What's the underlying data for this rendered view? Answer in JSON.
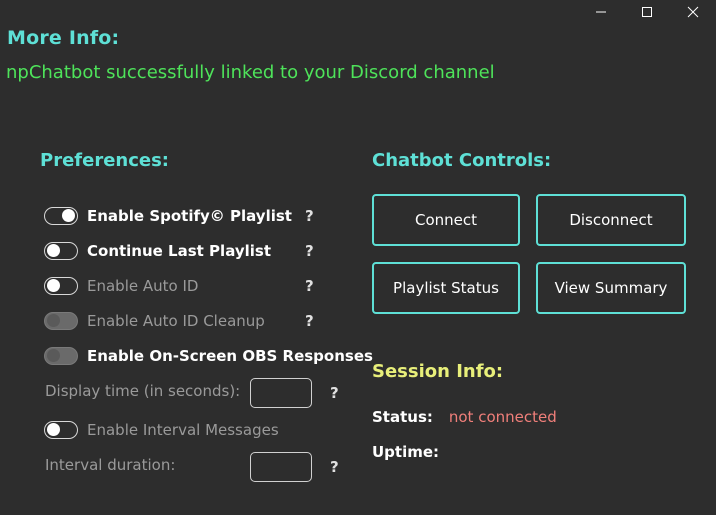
{
  "window": {
    "minimize_icon": "minimize-icon",
    "maximize_icon": "maximize-icon",
    "close_icon": "close-icon"
  },
  "more_info": {
    "title": "More Info:",
    "message": "npChatbot successfully linked to your Discord channel"
  },
  "preferences": {
    "title": "Preferences:",
    "toggles": [
      {
        "label": "Enable Spotify© Playlist",
        "state": "on",
        "enabled": true
      },
      {
        "label": "Continue Last Playlist",
        "state": "off",
        "enabled": true
      },
      {
        "label": "Enable Auto ID",
        "state": "off",
        "enabled": false
      },
      {
        "label": "Enable Auto ID Cleanup",
        "state": "off",
        "enabled": false,
        "disabled": true
      },
      {
        "label": "Enable On-Screen OBS Responses",
        "state": "off",
        "enabled": true,
        "disabled": true
      },
      {
        "label": "Enable Interval Messages",
        "state": "off",
        "enabled": false
      }
    ],
    "help": "?",
    "display_time": {
      "label": "Display time (in seconds):",
      "value": ""
    },
    "interval_duration": {
      "label": "Interval duration:",
      "value": ""
    }
  },
  "controls": {
    "title": "Chatbot Controls:",
    "connect": "Connect",
    "disconnect": "Disconnect",
    "playlist_status": "Playlist Status",
    "view_summary": "View Summary"
  },
  "session": {
    "title": "Session Info:",
    "status_label": "Status:",
    "status_value": "not connected",
    "uptime_label": "Uptime:"
  },
  "colors": {
    "background": "#2d2d2d",
    "accent": "#5ee0d6",
    "success": "#4ee35a",
    "session_title": "#e8ef7a",
    "status_error": "#f07f7a"
  }
}
